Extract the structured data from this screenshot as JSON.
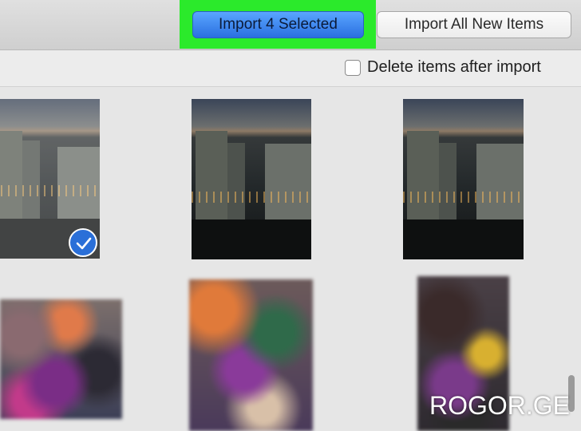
{
  "toolbar": {
    "import_selected_label": "Import 4 Selected",
    "import_all_label": "Import All New Items",
    "highlight_color": "#2bea2b",
    "accent_color": "#2f7ef0"
  },
  "options": {
    "delete_after_import_label": "Delete items after import",
    "delete_after_import_checked": false
  },
  "grid": {
    "thumbnails": [
      {
        "row": 1,
        "col": 1,
        "content": "night-city-photo",
        "selected": true
      },
      {
        "row": 1,
        "col": 2,
        "content": "night-city-photo",
        "selected": false
      },
      {
        "row": 1,
        "col": 3,
        "content": "night-city-photo",
        "selected": false
      },
      {
        "row": 2,
        "col": 1,
        "content": "blurred-photo",
        "selected": false
      },
      {
        "row": 2,
        "col": 2,
        "content": "blurred-photo",
        "selected": false
      },
      {
        "row": 2,
        "col": 3,
        "content": "blurred-photo",
        "selected": false
      }
    ]
  },
  "watermark": {
    "text": "ROGOR.GE"
  },
  "icons": {
    "checkmark": "checkmark-icon"
  }
}
